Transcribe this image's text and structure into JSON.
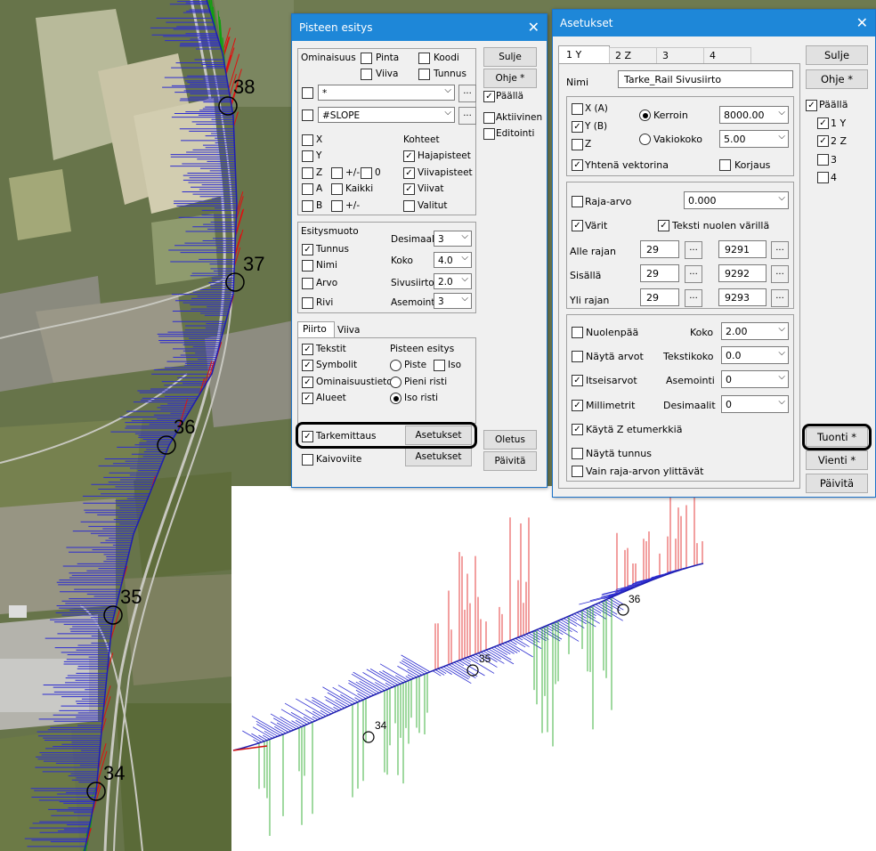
{
  "colors": {
    "titlebar": "#1e87d8",
    "aerial_forest": "#5d6b3e",
    "vector_blue": "#2d2dd0",
    "vector_red": "#e01010",
    "vector_green": "#11a011"
  },
  "map": {
    "km_labels": [
      "38",
      "37",
      "36",
      "35",
      "34"
    ]
  },
  "profile": {
    "km_labels": [
      "36",
      "35",
      "34"
    ]
  },
  "pisteen": {
    "title": "Pisteen esitys",
    "close_icon": "✕",
    "ominaisuus": "Ominaisuus",
    "top_checks": [
      "Pinta",
      "Koodi",
      "Viiva",
      "Tunnus"
    ],
    "sel1": "*",
    "sel2": "#SLOPE",
    "dots": "...",
    "col1": [
      "X",
      "Y",
      "Z",
      "A",
      "B"
    ],
    "pm": "+/-",
    "zero": "0",
    "kaikki": "Kaikki",
    "kohteet": "Kohteet",
    "kohteet_items": [
      "Hajapisteet",
      "Viivapisteet",
      "Viivat",
      "Valitut"
    ],
    "esitysmuoto": "Esitysmuoto",
    "esitys_items": [
      "Tunnus",
      "Nimi",
      "Arvo",
      "Rivi"
    ],
    "desimaalit": "Desimaalit",
    "desimaalit_val": "3",
    "koko": "Koko",
    "koko_val": "4.0",
    "sivusiirto": "Sivusiirto",
    "sivusiirto_val": "2.0",
    "asemointi": "Asemointi",
    "asemointi_val": "3",
    "tabs": [
      "Piirto",
      "Viiva"
    ],
    "piirto_items": [
      "Tekstit",
      "Symbolit",
      "Ominaisuustieto",
      "Alueet"
    ],
    "pisteen_esitys": "Pisteen esitys",
    "piste": "Piste",
    "iso": "Iso",
    "pieni_risti": "Pieni risti",
    "iso_risti": "Iso risti",
    "tarkemittaus": "Tarkemittaus",
    "kaivoviite": "Kaivoviite",
    "asetukset": "Asetukset",
    "buttons": {
      "sulje": "Sulje",
      "ohje": "Ohje *",
      "paalla": "Päällä",
      "aktiivinen": "Aktiivinen",
      "editointi": "Editointi",
      "oletus": "Oletus",
      "paivita": "Päivitä"
    }
  },
  "asetukset": {
    "title": "Asetukset",
    "close_icon": "✕",
    "tabs": [
      "1 Y",
      "2 Z",
      "3",
      "4"
    ],
    "nimi": "Nimi",
    "nimi_val": "Tarke_Rail Sivusiirto",
    "x": "X (A)",
    "y": "Y (B)",
    "z": "Z",
    "kerroin": "Kerroin",
    "kerroin_val": "8000.00",
    "vakiokoko": "Vakiokoko",
    "vakiokoko_val": "5.00",
    "yhtena": "Yhtenä vektorina",
    "korjaus": "Korjaus",
    "raja": "Raja-arvo",
    "raja_val": "0.000",
    "varit": "Värit",
    "teksti_nuolen": "Teksti nuolen värillä",
    "rows": [
      {
        "label": "Alle rajan",
        "a": "29",
        "b": "9291"
      },
      {
        "label": "Sisällä",
        "a": "29",
        "b": "9292"
      },
      {
        "label": "Yli rajan",
        "a": "29",
        "b": "9293"
      }
    ],
    "dots": "...",
    "nuolenpaa": "Nuolenpää",
    "koko": "Koko",
    "koko_val": "2.00",
    "nayta_arvot": "Näytä arvot",
    "tekstikoko": "Tekstikoko",
    "tekstikoko_val": "0.0",
    "itseisarvot": "Itseisarvot",
    "asemointi": "Asemointi",
    "asemointi_val": "0",
    "millimetrit": "Millimetrit",
    "desimaalit": "Desimaalit",
    "desimaalit_val": "0",
    "kayta_z": "Käytä Z etumerkkiä",
    "nayta_tunnus": "Näytä tunnus",
    "vain_raja": "Vain raja-arvon ylittävät",
    "buttons": {
      "sulje": "Sulje",
      "ohje": "Ohje *",
      "paalla": "Päällä",
      "tuonti": "Tuonti *",
      "vienti": "Vienti *",
      "paivita": "Päivitä"
    },
    "layers": [
      "1 Y",
      "2 Z",
      "3",
      "4"
    ]
  }
}
